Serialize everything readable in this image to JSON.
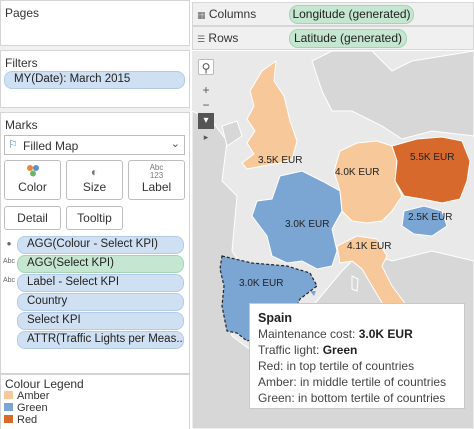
{
  "pages": {
    "title": "Pages"
  },
  "filters": {
    "title": "Filters",
    "items": [
      "MY(Date): March 2015"
    ]
  },
  "marks": {
    "title": "Marks",
    "mark_type": "Filled Map",
    "buttons": {
      "color": "Color",
      "size": "Size",
      "label": "Label",
      "detail": "Detail",
      "tooltip": "Tooltip"
    },
    "fields": [
      "AGG(Colour - Select KPI)",
      "AGG(Select KPI)",
      "Label - Select KPI",
      "Country",
      "Select KPI",
      "ATTR(Traffic Lights per Meas.."
    ]
  },
  "legend": {
    "title": "Colour Legend",
    "items": [
      {
        "label": "Amber",
        "color": "#f6c89a"
      },
      {
        "label": "Green",
        "color": "#7ba6d3"
      },
      {
        "label": "Red",
        "color": "#d8692c"
      }
    ]
  },
  "shelves": {
    "columns_label": "Columns",
    "columns_value": "Longitude (generated)",
    "rows_label": "Rows",
    "rows_value": "Latitude (generated)"
  },
  "map_labels": {
    "uk": "3.5K EUR",
    "germany": "4.0K EUR",
    "poland": "5.5K EUR",
    "france": "3.0K EUR",
    "hungary": "2.5K EUR",
    "italy": "4.1K EUR",
    "spain": "3.0K EUR"
  },
  "tooltip": {
    "title": "Spain",
    "cost_label": "Maintenance cost:",
    "cost_value": "3.0K EUR",
    "light_label": "Traffic light:",
    "light_value": "Green",
    "line_red": "Red: in top tertile of countries",
    "line_amber": "Amber: in middle tertile of countries",
    "line_green": "Green: in bottom tertile of countries"
  }
}
